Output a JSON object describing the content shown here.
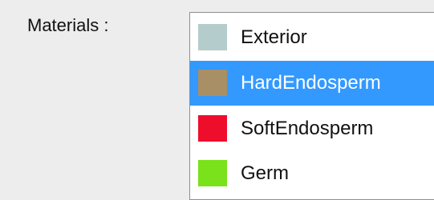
{
  "materials": {
    "label": "Materials :",
    "items": [
      {
        "name": "Exterior",
        "color": "#b4cccb",
        "selected": false
      },
      {
        "name": "HardEndosperm",
        "color": "#a88f65",
        "selected": true
      },
      {
        "name": "SoftEndosperm",
        "color": "#ee0e2c",
        "selected": false
      },
      {
        "name": "Germ",
        "color": "#7ae21a",
        "selected": false
      }
    ]
  }
}
